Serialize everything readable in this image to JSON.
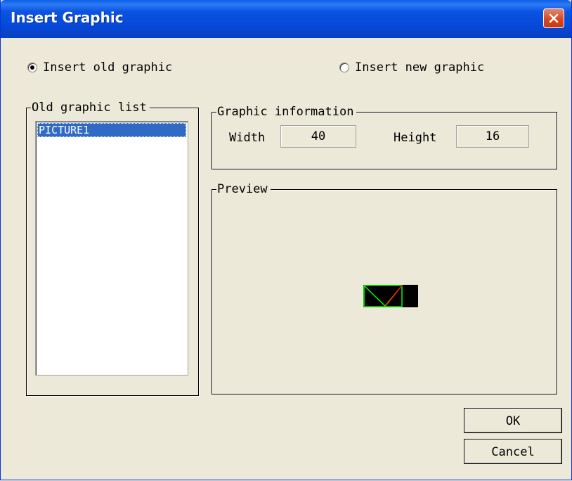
{
  "window": {
    "title": "Insert Graphic"
  },
  "options": {
    "insert_old": {
      "label": "Insert old graphic",
      "checked": true
    },
    "insert_new": {
      "label": "Insert new graphic",
      "checked": false
    }
  },
  "old_list": {
    "title": "Old graphic list",
    "items": [
      "PICTURE1"
    ],
    "selected_index": 0
  },
  "graphic_info": {
    "title": "Graphic information",
    "width_label": "Width",
    "width_value": "40",
    "height_label": "Height",
    "height_value": "16"
  },
  "preview": {
    "title": "Preview"
  },
  "buttons": {
    "ok": "OK",
    "cancel": "Cancel"
  },
  "colors": {
    "titlebar": "#0548d8",
    "selection": "#316ac5",
    "preview_line_green": "#00ff00",
    "preview_line_red": "#ff0000"
  }
}
